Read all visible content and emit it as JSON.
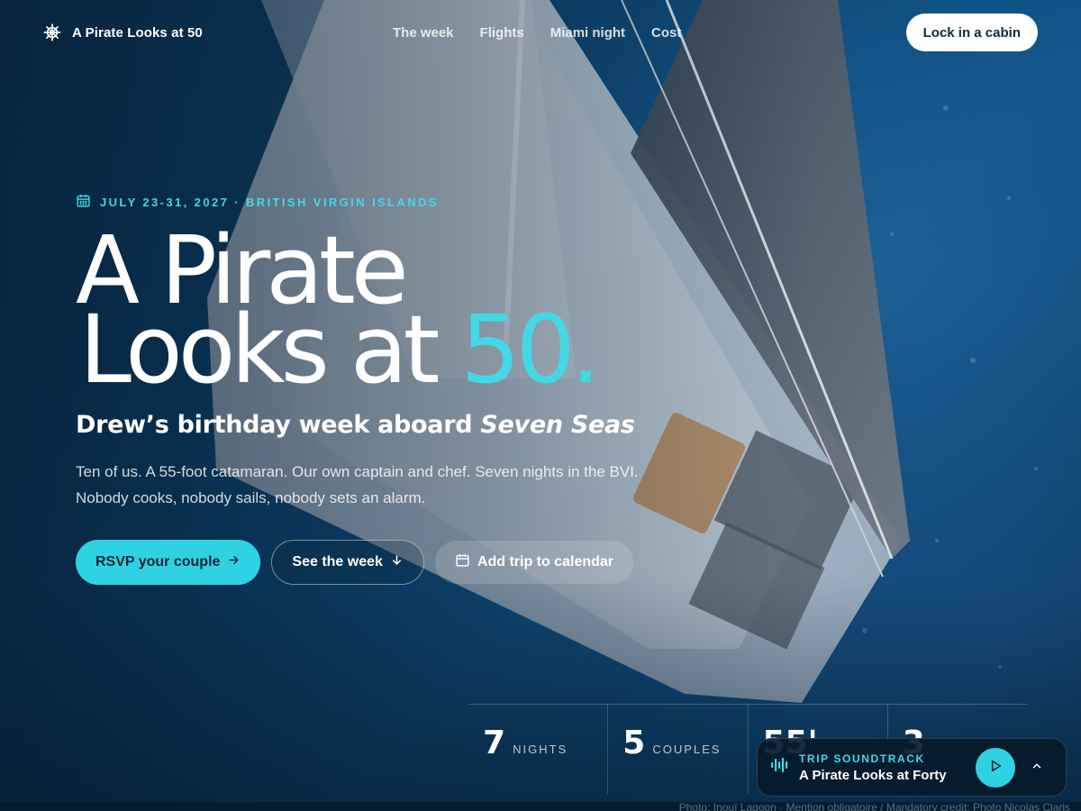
{
  "colors": {
    "accent": "#44d7e5",
    "primary_button": "#2fd2e2",
    "ocean_dark": "#0c3a5c",
    "player_bg": "#061a2a"
  },
  "nav": {
    "brand_icon": "ship-wheel-icon",
    "brand": "A Pirate Looks at 50",
    "links": [
      "The week",
      "Flights",
      "Miami night",
      "Cost"
    ],
    "cta": "Lock in a cabin"
  },
  "hero": {
    "eyebrow_icon": "calendar-icon",
    "eyebrow": "JULY 23-31, 2027 · BRITISH VIRGIN ISLANDS",
    "headline_line1": "A Pirate",
    "headline_line2_prefix": "Looks at",
    "headline_accent": "50.",
    "subhead_prefix": "Drew’s birthday week aboard",
    "subhead_boat": "Seven Seas",
    "lede": "Ten of us. A 55-foot catamaran. Our own captain and chef. Seven nights in the BVI. Nobody cooks, nobody sails, nobody sets an alarm.",
    "buttons": {
      "rsvp": "RSVP your couple",
      "rsvp_icon": "arrow-right-icon",
      "week": "See the week",
      "week_icon": "arrow-down-icon",
      "calendar": "Add trip to calendar",
      "calendar_icon": "calendar-icon"
    }
  },
  "stats": [
    {
      "value": "7",
      "label": "NIGHTS"
    },
    {
      "value": "5",
      "label": "COUPLES"
    },
    {
      "value": "55'",
      "label": ""
    },
    {
      "value": "3",
      "label": ""
    }
  ],
  "player": {
    "icon": "audio-waveform-icon",
    "kicker": "TRIP SOUNDTRACK",
    "title": "A Pirate Looks at Forty",
    "play_icon": "play-icon",
    "collapse_icon": "chevron-up-icon"
  },
  "credit": "Photo: Inouï Lagoon · Mention obligatoire / Mandatory credit: Photo Nicolas Claris"
}
